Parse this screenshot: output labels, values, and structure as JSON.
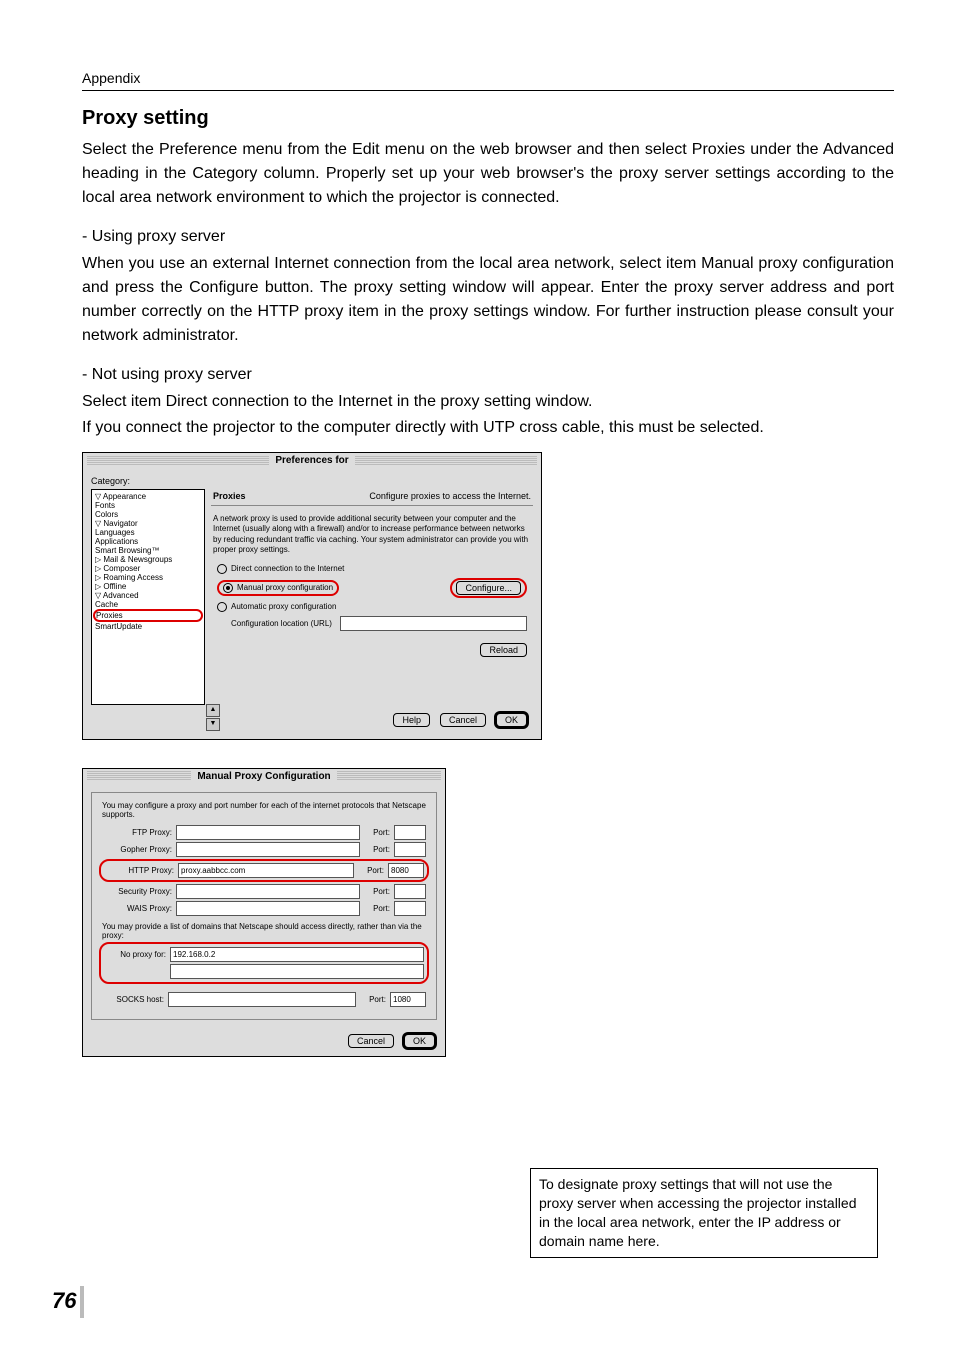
{
  "header": "Appendix",
  "section_title": "Proxy setting",
  "p1": "Select the Preference menu from the Edit menu on the web browser and then select Proxies under the Advanced heading in the Category column. Properly set up your web browser's the proxy server settings according to the local area network environment to which the projector is connected.",
  "sub1": "- Using proxy server",
  "p2": "When you use an external Internet connection from the local area network, select item Manual proxy configuration and press the Configure button. The proxy setting window will appear. Enter the proxy server address and port number correctly on the HTTP proxy item in the proxy settings window. For further instruction please consult your network administrator.",
  "sub2": "- Not using proxy server",
  "p3a": "Select item Direct connection to the Internet in the proxy setting window.",
  "p3b": "If you connect the projector to the computer directly with UTP cross cable, this must be selected.",
  "prefs": {
    "title": "Preferences for",
    "category_label": "Category:",
    "categories": [
      "▽ Appearance",
      "    Fonts",
      "    Colors",
      "▽ Navigator",
      "    Languages",
      "    Applications",
      "    Smart Browsing™",
      "▷ Mail & Newsgroups",
      "▷ Composer",
      "▷ Roaming Access",
      "▷ Offline",
      "▽ Advanced",
      "    Cache",
      "    Proxies",
      "    SmartUpdate"
    ],
    "panel_head_left": "Proxies",
    "panel_head_right": "Configure proxies to access the Internet.",
    "desc": "A network proxy is used to provide additional security between your computer and the Internet (usually along with a firewall) and/or to increase performance between networks by reducing redundant traffic via caching. Your system administrator can provide you with proper proxy settings.",
    "radio1": "Direct connection to the Internet",
    "radio2": "Manual proxy configuration",
    "configure_btn": "Configure...",
    "radio3": "Automatic proxy configuration",
    "url_label": "Configuration location (URL)",
    "reload_btn": "Reload",
    "help": "Help",
    "cancel": "Cancel",
    "ok": "OK"
  },
  "manual": {
    "title": "Manual Proxy Configuration",
    "desc1": "You may configure a proxy and port number for each of the internet protocols that Netscape supports.",
    "rows": [
      {
        "label": "FTP Proxy:",
        "host": "",
        "port": ""
      },
      {
        "label": "Gopher Proxy:",
        "host": "",
        "port": ""
      },
      {
        "label": "HTTP Proxy:",
        "host": "proxy.aabbcc.com",
        "port": "8080"
      },
      {
        "label": "Security Proxy:",
        "host": "",
        "port": ""
      },
      {
        "label": "WAIS Proxy:",
        "host": "",
        "port": ""
      }
    ],
    "port_label": "Port:",
    "desc2": "You may provide a list of domains that Netscape should access directly, rather than via the proxy:",
    "noproxy_label": "No proxy for:",
    "noproxy_value": "192.168.0.2",
    "socks_label": "SOCKS host:",
    "socks_port": "1080",
    "cancel": "Cancel",
    "ok": "OK"
  },
  "callout": "To designate proxy settings that will not use the proxy server when accessing the projector installed in the local area network, enter the IP address or domain name here.",
  "page_number": "76"
}
